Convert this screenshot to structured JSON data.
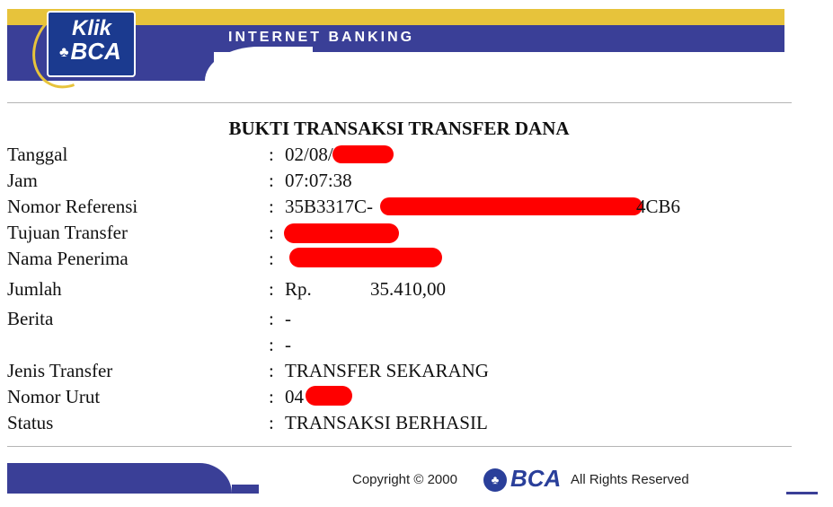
{
  "header": {
    "title": "INTERNET BANKING",
    "logo_top": "Klik",
    "logo_bottom": "BCA",
    "logo_mark": "♣",
    "colors": {
      "blue": "#3a3f97",
      "yellow": "#e7c33b",
      "logo_blue": "#1b3a8f"
    }
  },
  "receipt": {
    "title": "BUKTI TRANSAKSI TRANSFER DANA",
    "rows": [
      {
        "label": "Tanggal",
        "colon": ":",
        "value": "02/08/"
      },
      {
        "label": "Jam",
        "colon": ":",
        "value": "07:07:38"
      },
      {
        "label": "Nomor Referensi",
        "colon": ":",
        "value": "35B3317C-",
        "value_suffix": "4CB6"
      },
      {
        "label": "Tujuan Transfer",
        "colon": ":",
        "value": ""
      },
      {
        "label": "Nama Penerima",
        "colon": ":",
        "value": ""
      },
      {
        "label": "Jumlah",
        "colon": ":",
        "value": "Rp.",
        "amount": "35.410,00"
      },
      {
        "label": "Berita",
        "colon": ":",
        "value": "-"
      },
      {
        "label": "",
        "colon": ":",
        "value": "-"
      },
      {
        "label": "Jenis Transfer",
        "colon": ":",
        "value": "TRANSFER SEKARANG"
      },
      {
        "label": "Nomor Urut",
        "colon": ":",
        "value": "04"
      },
      {
        "label": "Status",
        "colon": ":",
        "value": "TRANSAKSI BERHASIL"
      }
    ],
    "redaction_color": "#ff0000"
  },
  "footer": {
    "copyright": "Copyright © 2000",
    "brand": "BCA",
    "rights": "All Rights Reserved"
  }
}
